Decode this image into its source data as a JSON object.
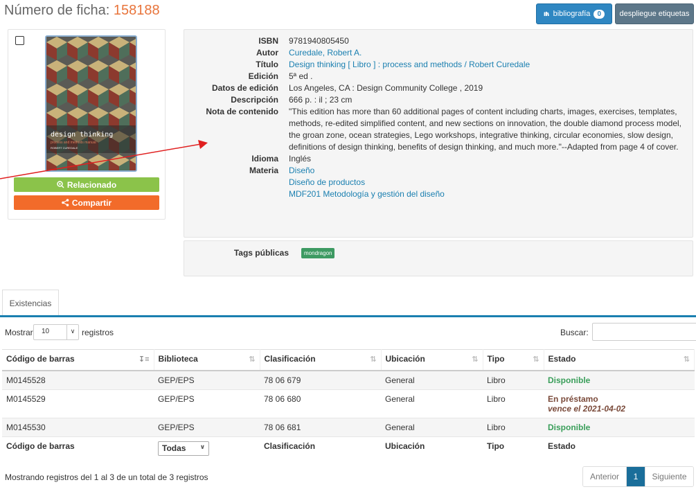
{
  "header": {
    "title_label": "Número de ficha:",
    "record_number": "158188",
    "biblio_button": "bibliografía",
    "biblio_count": "0",
    "labels_button": "despliegue etiquetas"
  },
  "cover": {
    "title": "design thinking",
    "subtitle": "process and methods manual",
    "author": "ROBERT CUREDALE",
    "related_button": "Relacionado",
    "share_button": "Compartir"
  },
  "details": [
    {
      "key": "ISBN",
      "value": "9781940805450",
      "link": false
    },
    {
      "key": "Autor",
      "value": "Curedale, Robert A.",
      "link": true
    },
    {
      "key": "Título",
      "value": "Design thinking [ Libro ] : process and methods / Robert Curedale",
      "link": true
    },
    {
      "key": "Edición",
      "value": "5ª ed .",
      "link": false
    },
    {
      "key": "Datos de edición",
      "value": "Los Angeles, CA : Design Community College , 2019",
      "link": false
    },
    {
      "key": "Descripción",
      "value": "666 p. : il ; 23 cm",
      "link": false
    },
    {
      "key": "Nota de contenido",
      "value": "\"This edition has more than 60 additional pages of content including charts, images, exercises, templates, methods, re-edited simplified content, and new sections on innovation, the double diamond process model, the groan zone, ocean strategies, Lego workshops, integrative thinking, circular economies, slow design, definitions of design thinking, benefits of design thinking, and much more.\"--Adapted from page 4 of cover.",
      "link": false
    },
    {
      "key": "Idioma",
      "value": "Inglés",
      "link": false
    }
  ],
  "subjects_label": "Materia",
  "subjects": [
    "Diseño",
    "Diseño de productos",
    "MDF201 Metodología y gestión del diseño"
  ],
  "tags": {
    "label": "Tags públicas",
    "items": [
      "mondragon"
    ]
  },
  "tab_label": "Existencias",
  "controls": {
    "show_label": "Mostrar",
    "show_value": "10",
    "show_suffix": "registros",
    "search_label": "Buscar:"
  },
  "table": {
    "columns": [
      "Código de barras",
      "Biblioteca",
      "Clasificación",
      "Ubicación",
      "Tipo",
      "Estado"
    ],
    "rows": [
      {
        "barcode": "M0145528",
        "library": "GEP/EPS",
        "class": "78 06 679",
        "location": "General",
        "type": "Libro",
        "status": "Disponible",
        "due": ""
      },
      {
        "barcode": "M0145529",
        "library": "GEP/EPS",
        "class": "78 06 680",
        "location": "General",
        "type": "Libro",
        "status": "En préstamo",
        "due": "vence el 2021-04-02"
      },
      {
        "barcode": "M0145530",
        "library": "GEP/EPS",
        "class": "78 06 681",
        "location": "General",
        "type": "Libro",
        "status": "Disponible",
        "due": ""
      }
    ],
    "filter_value": "Todas"
  },
  "footer": {
    "info": "Mostrando registros del 1 al 3 de un total de 3 registros",
    "prev": "Anterior",
    "page": "1",
    "next": "Siguiente"
  },
  "colors": {
    "accent": "#1a7fb0",
    "record_number": "#e8743b",
    "available": "#3a9e5a",
    "loan": "#7a4a3a",
    "related": "#8bc34a",
    "share": "#f26b2a",
    "arrow": "#e02020"
  }
}
